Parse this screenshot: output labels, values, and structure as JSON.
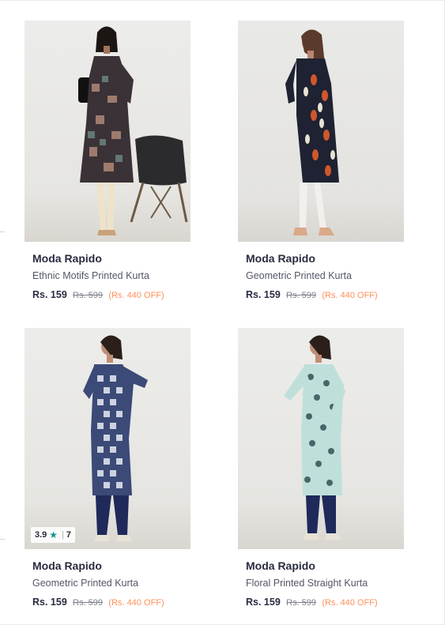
{
  "colors": {
    "star": "#14958f",
    "discount": "#ff905a"
  },
  "products": [
    {
      "brand": "Moda Rapido",
      "name": "Ethnic Motifs Printed Kurta",
      "price": "Rs. 159",
      "mrp": "Rs. 599",
      "discount": "(Rs. 440 OFF)"
    },
    {
      "brand": "Moda Rapido",
      "name": "Geometric Printed Kurta",
      "price": "Rs. 159",
      "mrp": "Rs. 599",
      "discount": "(Rs. 440 OFF)"
    },
    {
      "brand": "Moda Rapido",
      "name": "Geometric Printed Kurta",
      "price": "Rs. 159",
      "mrp": "Rs. 599",
      "discount": "(Rs. 440 OFF)",
      "rating": {
        "value": "3.9",
        "count": "7",
        "icon": "star-icon"
      }
    },
    {
      "brand": "Moda Rapido",
      "name": "Floral Printed Straight Kurta",
      "price": "Rs. 159",
      "mrp": "Rs. 599",
      "discount": "(Rs. 440 OFF)"
    }
  ]
}
